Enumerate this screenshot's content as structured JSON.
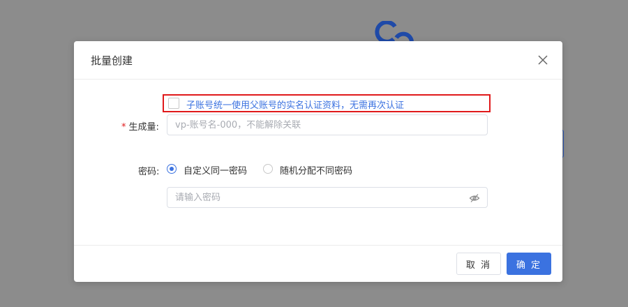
{
  "dialog": {
    "title": "批量创建",
    "checkbox_label": "子账号统一使用父账号的实名认证资料，无需再次认证",
    "quantity_label": "生成量:",
    "quantity_placeholder": "vp-账号名-000，不能解除关联",
    "password_label": "密码:",
    "password_options": [
      "自定义同一密码",
      "随机分配不同密码"
    ],
    "password_selected": "自定义同一密码",
    "password_placeholder": "请输入密码",
    "cancel_label": "取 消",
    "confirm_label": "确 定"
  },
  "colors": {
    "accent": "#3b72e0",
    "highlight_border": "#e0191b",
    "required": "#e0191b",
    "backdrop": "#8c8c8c"
  },
  "icons": {
    "close": "close-icon",
    "eye": "eye-off-icon",
    "backdrop_logo": "logo-icon"
  }
}
